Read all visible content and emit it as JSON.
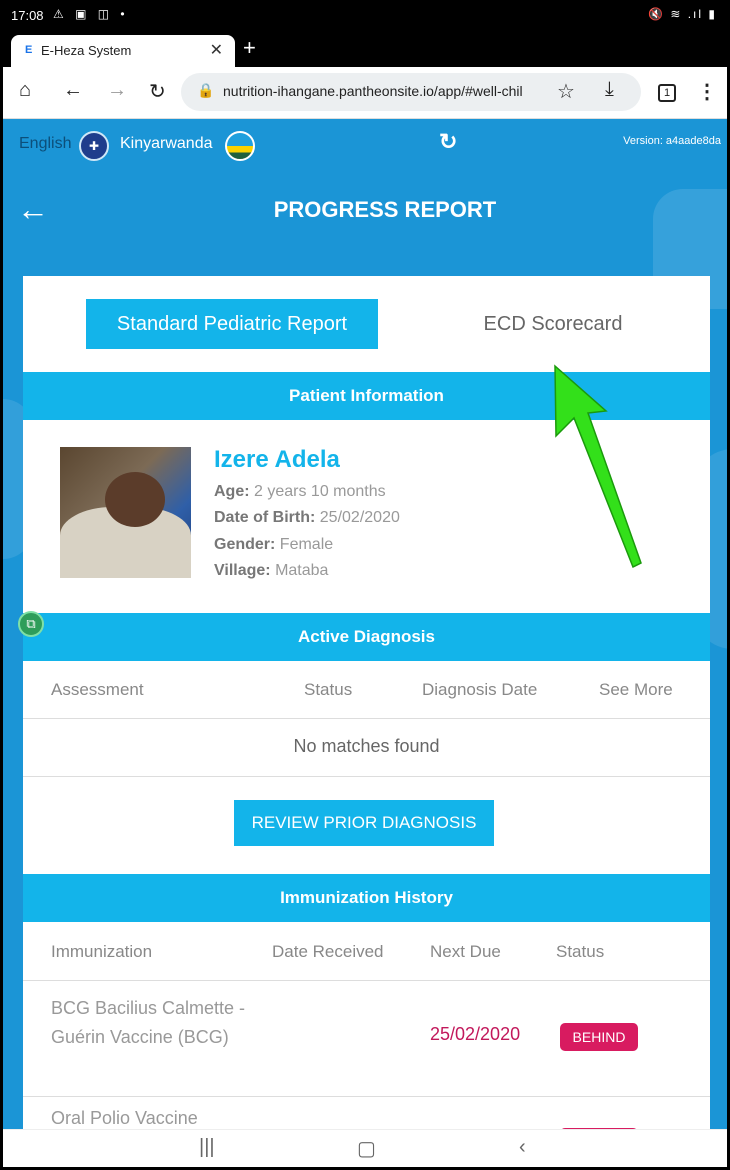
{
  "status_bar": {
    "time": "17:08",
    "left_icons": "⚠ ▣ ◫ •",
    "right_icons": "🔇 ≋ .ıl ▮"
  },
  "browser": {
    "tab_favicon": "E",
    "tab_title": "E-Heza System",
    "tab_close": "✕",
    "new_tab": "+",
    "url": "nutrition-ihangane.pantheonsite.io/app/#well-child",
    "tab_count": "1"
  },
  "app": {
    "lang_english": "English",
    "lang_kinyarwanda": "Kinyarwanda",
    "version": "Version: a4aade8da",
    "page_title": "PROGRESS REPORT",
    "tabs": {
      "standard": "Standard Pediatric Report",
      "ecd": "ECD Scorecard"
    }
  },
  "patient": {
    "section_title": "Patient Information",
    "name": "Izere Adela",
    "age_label": "Age:",
    "age": "2 years 10 months",
    "dob_label": "Date of Birth:",
    "dob": "25/02/2020",
    "gender_label": "Gender:",
    "gender": "Female",
    "village_label": "Village:",
    "village": "Mataba"
  },
  "diagnosis": {
    "section_title": "Active Diagnosis",
    "columns": [
      "Assessment",
      "Status",
      "Diagnosis Date",
      "See More"
    ],
    "empty": "No matches found",
    "review_button": "REVIEW PRIOR DIAGNOSIS"
  },
  "immunization": {
    "section_title": "Immunization History",
    "columns": [
      "Immunization",
      "Date Received",
      "Next Due",
      "Status"
    ],
    "rows": [
      {
        "name": "BCG Bacilius Calmette - Guérin Vaccine (BCG)",
        "next_due": "25/02/2020",
        "status": "BEHIND"
      },
      {
        "name": "Oral Polio Vaccine",
        "next_due": "",
        "status": ""
      }
    ]
  },
  "colors": {
    "header_blue": "#1b95d6",
    "accent_cyan": "#13b4ea",
    "behind_pink": "#d81b60",
    "annotation_arrow": "#33e01a"
  }
}
